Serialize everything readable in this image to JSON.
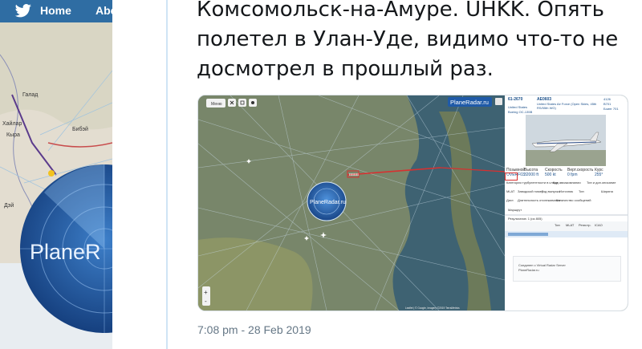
{
  "twitter_nav": {
    "home_label": "Home",
    "about_label": "Abo"
  },
  "bg_radar_watermark": "PlaneR",
  "bg_map_labels": [
    "Галад",
    "Хайлар",
    "Кыра",
    "Бибэй",
    "Дэй"
  ],
  "tweet": {
    "lines": [
      "Комсомольск-на-Амуре. UHKK. Опять",
      "полетел в Улан-Уде, видимо что-то не",
      "досмотрел в прошлый раз."
    ],
    "timestamp": "7:08 pm - 28 Feb 2019"
  },
  "screenshot": {
    "menu_label": "Меню",
    "brand": "PlaneRadar.ru",
    "radar_label": "PlaneRadar.ru",
    "map_attribution": "Leaflet | © Google, Imagery ©2019 TerraMetrics",
    "flight": {
      "callsign": "61-2670",
      "hex": "AE0603",
      "operator": "United States Air Force (Open Skies, 45th RS/55th WG)",
      "country": "United States",
      "type": "Boeing OC-135B",
      "model_code": "B701",
      "model_desc": "Боинг 701",
      "squawk": "4126",
      "fields": [
        {
          "label": "Позывной",
          "value": "OVERF03"
        },
        {
          "label": "Высота",
          "value": "32000 ft"
        },
        {
          "label": "Скорость",
          "value": "500 kt"
        },
        {
          "label": "Верт.скорость",
          "value": "0 fpm"
        },
        {
          "label": "Курс",
          "value": "255°"
        }
      ],
      "field_labels_2": [
        "Категория турбулентности в следе",
        "Код авиакомпании",
        "Тип и доп.описание"
      ],
      "field_labels_3": [
        "MLAT",
        "Заводской номер",
        "Год выпуска",
        "Источник",
        "Тип",
        "Ширина"
      ],
      "field_labels_4": [
        "Дист.",
        "Длительность отслеживания",
        "Количество сообщений"
      ],
      "note_label": "Маршрут",
      "results_label": "Результатов: 1 (из 805)",
      "table_headers": [
        "Тип",
        "MLAT",
        "Регистр.",
        "ICAO"
      ],
      "ad_lines": [
        "Соединен с Virtual Radar Server",
        "PlaneRadar.ru"
      ]
    }
  }
}
